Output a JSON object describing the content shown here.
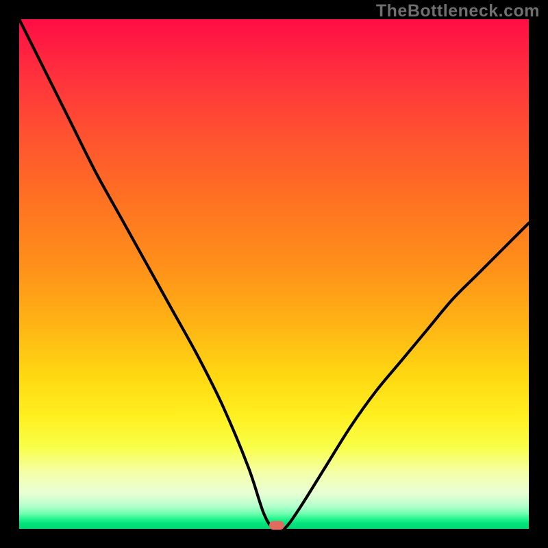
{
  "brand": "TheBottleneck.com",
  "colors": {
    "page_bg": "#000000",
    "curve_stroke": "#000000",
    "marker_fill": "#e26b5e",
    "brand_text": "#6f6f6f"
  },
  "chart_data": {
    "type": "line",
    "title": "",
    "xlabel": "",
    "ylabel": "",
    "xlim": [
      0,
      100
    ],
    "ylim": [
      0,
      100
    ],
    "grid": false,
    "legend": false,
    "series": [
      {
        "name": "bottleneck-curve",
        "x": [
          0,
          5,
          10,
          15,
          20,
          25,
          30,
          35,
          40,
          45,
          48,
          50,
          52,
          55,
          60,
          65,
          70,
          75,
          80,
          85,
          90,
          95,
          100
        ],
        "values": [
          100,
          90,
          80,
          70,
          61,
          52,
          43,
          34,
          24,
          12,
          3,
          0,
          0,
          4,
          12,
          20,
          27,
          33,
          39,
          45,
          50,
          55,
          60
        ]
      }
    ],
    "marker": {
      "x": 50.5,
      "y": 0.7
    },
    "annotations": []
  }
}
